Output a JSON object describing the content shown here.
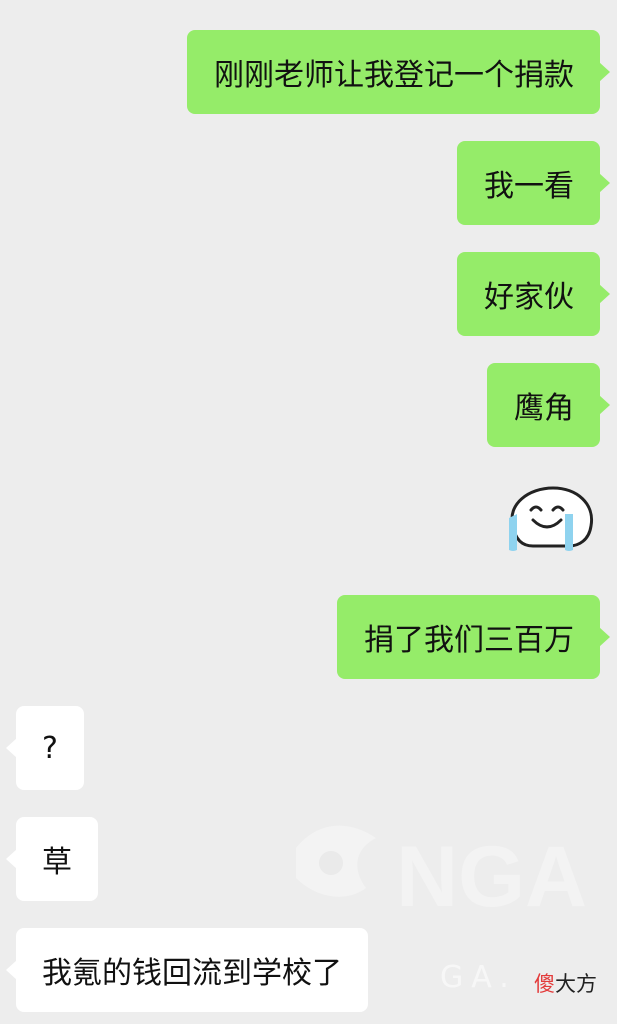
{
  "messages": [
    {
      "side": "sent",
      "text": "刚刚老师让我登记一个捐款"
    },
    {
      "side": "sent",
      "text": "我一看"
    },
    {
      "side": "sent",
      "text": "好家伙"
    },
    {
      "side": "sent",
      "text": "鹰角"
    },
    {
      "side": "sent",
      "sticker": "laughing-crying-ghost-icon"
    },
    {
      "side": "sent",
      "text": "捐了我们三百万"
    },
    {
      "side": "received",
      "text": "?"
    },
    {
      "side": "received",
      "text": "草"
    },
    {
      "side": "received",
      "text": "我氪的钱回流到学校了"
    }
  ],
  "watermark": {
    "logo_text": "NGA",
    "partial_text": "GA."
  },
  "brand": {
    "first_char": "傻",
    "rest": "大方"
  },
  "colors": {
    "background": "#ededed",
    "sent_bubble": "#95ec69",
    "received_bubble": "#ffffff",
    "brand_accent": "#e33a3a"
  }
}
